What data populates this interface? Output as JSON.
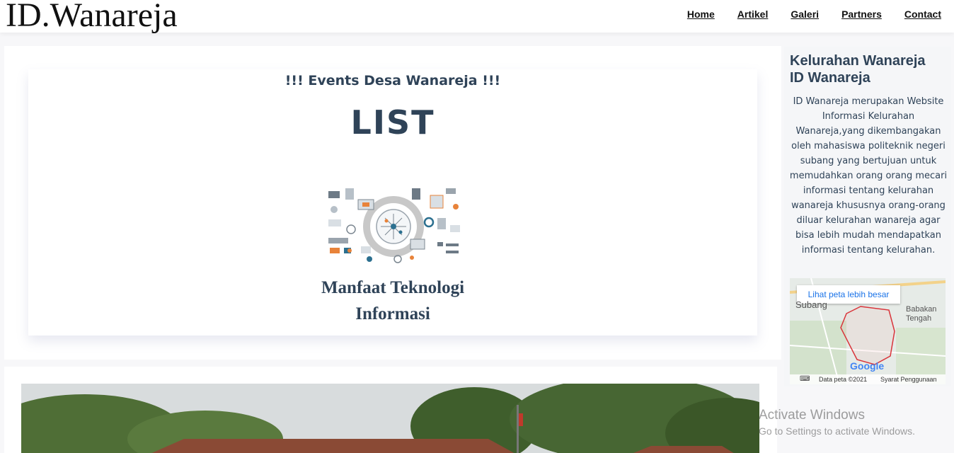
{
  "header": {
    "logo": "ID.Wanareja",
    "nav": [
      "Home",
      "Artikel",
      "Galeri",
      "Partners",
      "Contact"
    ]
  },
  "events": {
    "heading": "!!! Events Desa Wanareja !!!",
    "list_title": "LIST",
    "article_title_line1": "Manfaat Teknologi",
    "article_title_line2": "Informasi"
  },
  "sidebar": {
    "title_line1": "Kelurahan Wanareja",
    "title_line2": "ID Wanareja",
    "description": "ID Wanareja merupakan Website Informasi Kelurahan Wanareja,yang dikembangakan oleh mahasiswa politeknik negeri subang yang bertujuan untuk memudahkan orang orang mecari informasi tentang kelurahan wanareja khususnya orang-orang diluar kelurahan wanareja agar bisa lebih mudah mendapatkan informasi tentang kelurahan."
  },
  "map": {
    "button": "Lihat peta lebih besar",
    "label_subang": "Subang",
    "label_babakan": "Babakan",
    "label_tengah": "Tengah",
    "google": "Google",
    "data": "Data peta ©2021",
    "terms": "Syarat Penggunaan"
  },
  "watermark": {
    "title": "Activate Windows",
    "subtitle": "Go to Settings to activate Windows."
  }
}
